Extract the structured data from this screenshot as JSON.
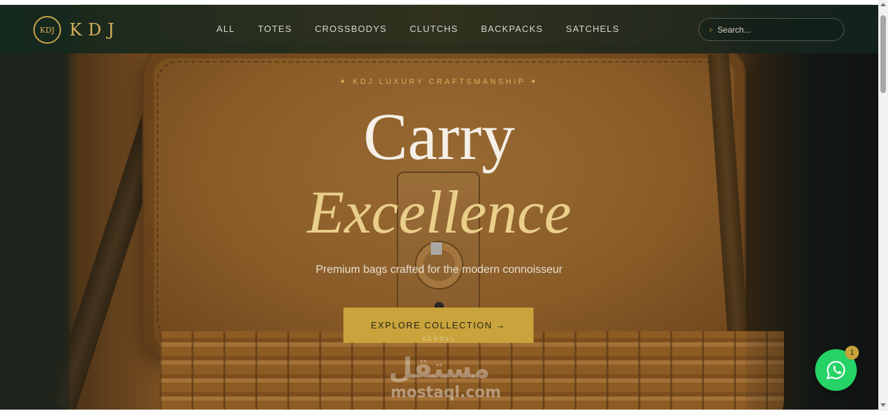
{
  "brand": {
    "logo_badge": "KDJ",
    "name": "KDJ"
  },
  "nav": {
    "links": [
      "ALL",
      "TOTES",
      "CROSSBODYS",
      "CLUTCHS",
      "BACKPACKS",
      "SATCHELS"
    ]
  },
  "search": {
    "placeholder": "Search...",
    "icon": "search-icon"
  },
  "hero": {
    "eyebrow": "✦ KDJ LUXURY CRAFTSMANSHIP ✦",
    "title_line1": "Carry",
    "title_line2": "Excellence",
    "subtitle": "Premium bags crafted for the modern connoisseur",
    "cta_label": "EXPLORE COLLECTION →",
    "scroll_label": "SCROLL"
  },
  "watermark": {
    "arabic": "مستقل",
    "latin": "mostaql.com"
  },
  "whatsapp": {
    "badge_count": "1",
    "icon": "whatsapp-icon"
  },
  "colors": {
    "gold": "#c9a33c",
    "nav_bg": "#142820",
    "whatsapp": "#25d366"
  }
}
